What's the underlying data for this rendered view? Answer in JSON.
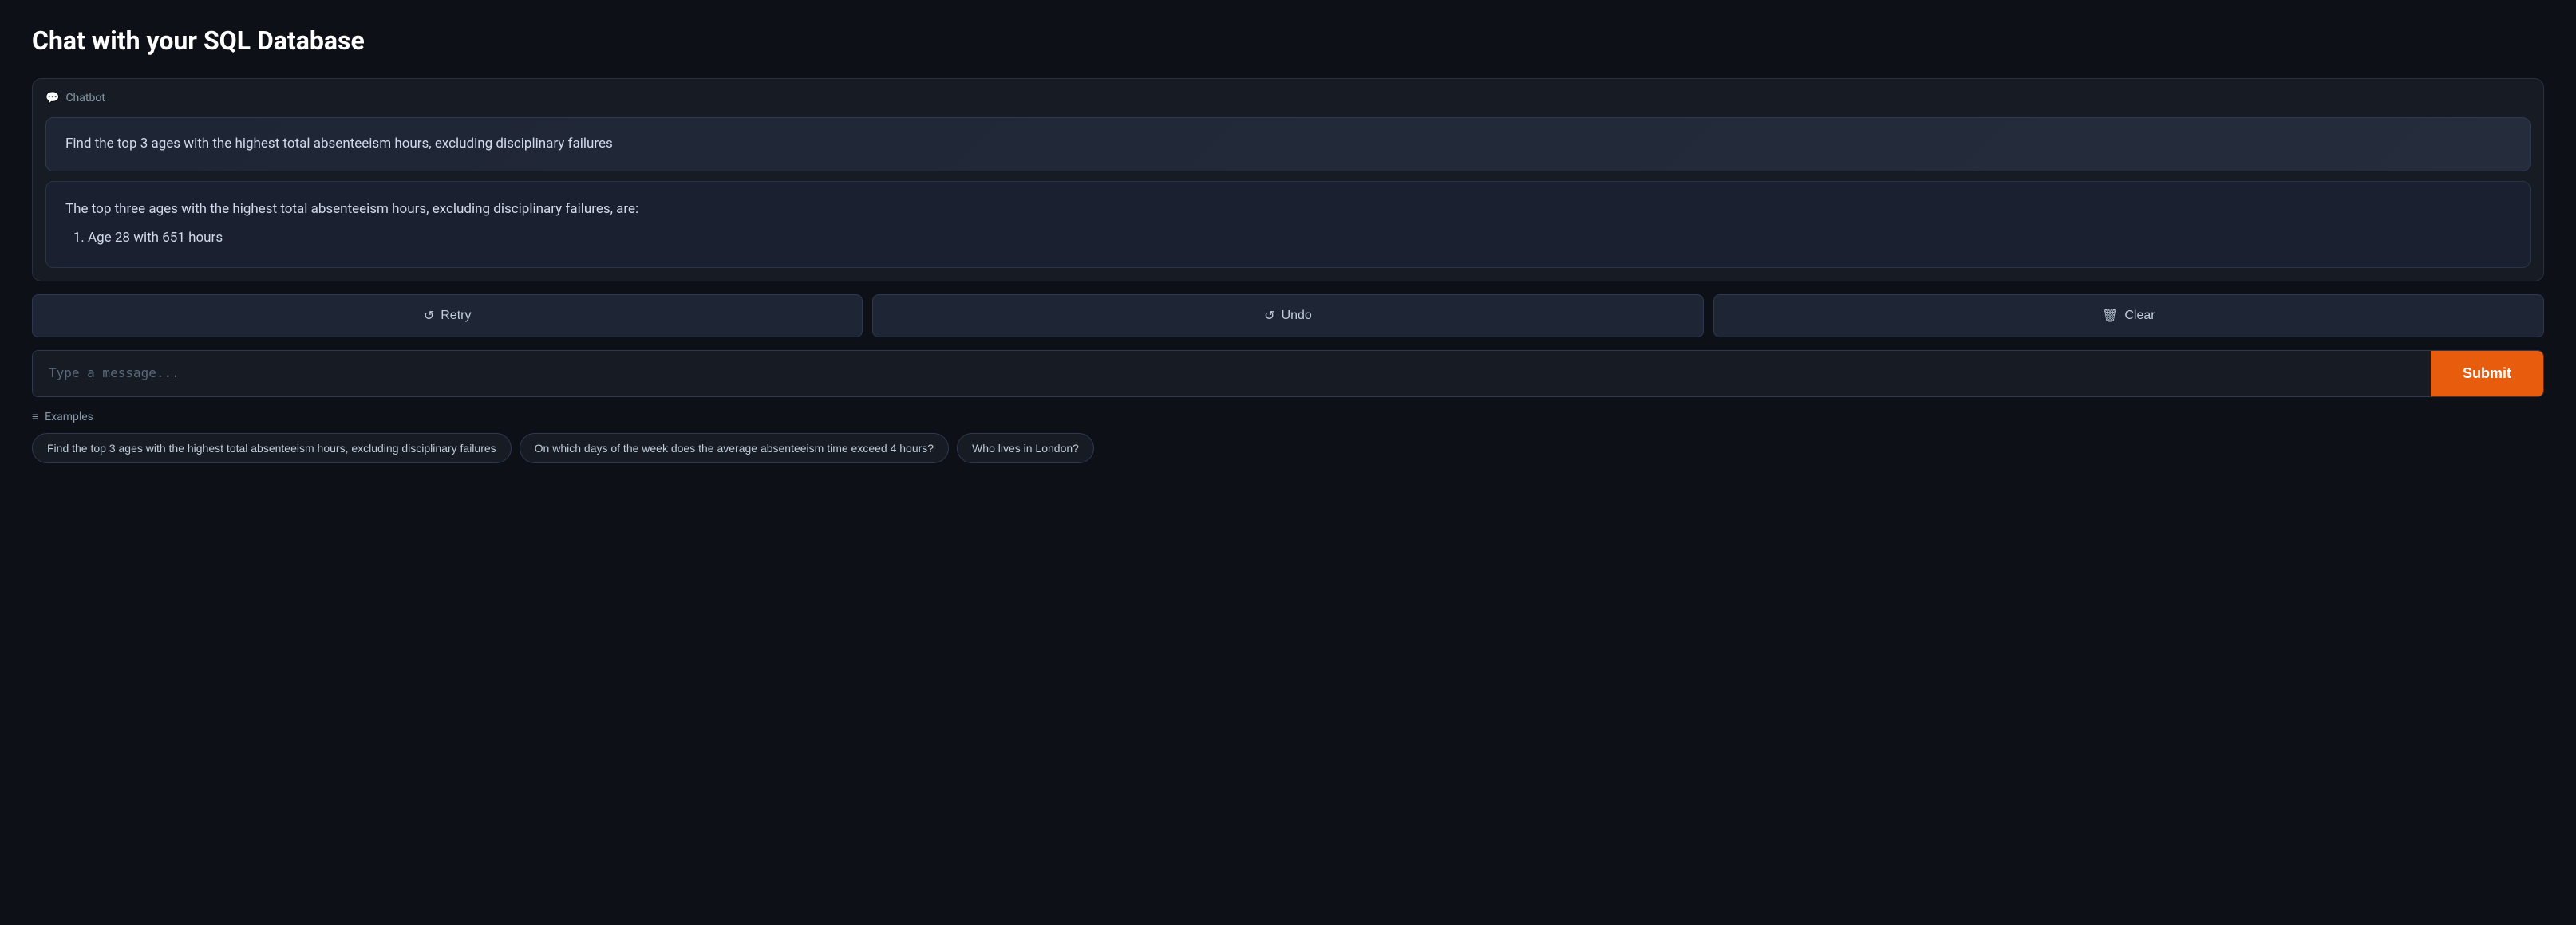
{
  "page": {
    "title": "Chat with your SQL Database"
  },
  "chatbot": {
    "label": "Chatbot",
    "header_icon": "💬"
  },
  "messages": [
    {
      "role": "user",
      "text": "Find the top 3 ages with the highest total absenteeism hours, excluding disciplinary failures"
    },
    {
      "role": "assistant",
      "intro": "The top three ages with the highest total absenteeism hours, excluding disciplinary failures, are:",
      "items": [
        "Age 28 with 651 hours"
      ]
    }
  ],
  "buttons": {
    "retry_label": "↺  Retry",
    "undo_label": "↺  Undo",
    "clear_label": "🗑  Clear",
    "submit_label": "Submit"
  },
  "input": {
    "placeholder": "Type a message..."
  },
  "examples": {
    "header": "Examples",
    "header_icon": "≡",
    "chips": [
      "Find the top 3 ages with the highest total absenteeism hours, excluding disciplinary failures",
      "On which days of the week does the average absenteeism time exceed 4 hours?",
      "Who lives in London?"
    ]
  }
}
